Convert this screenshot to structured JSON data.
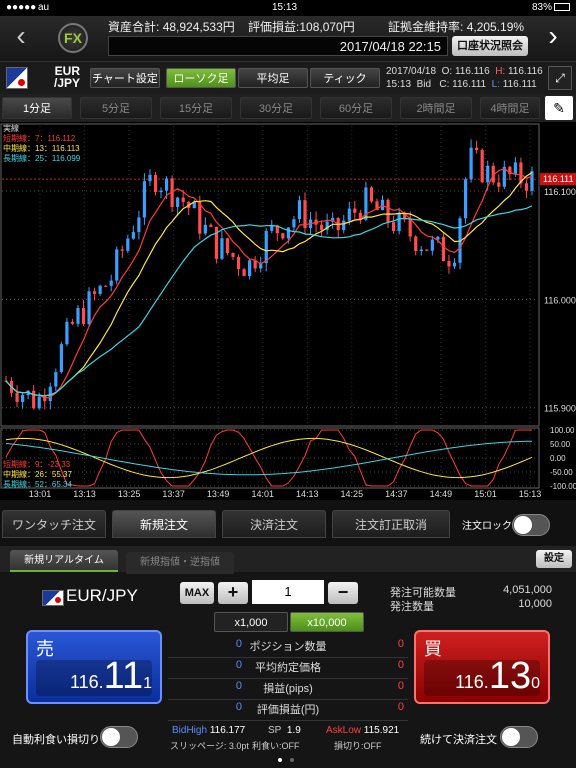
{
  "status_bar": {
    "carrier": "au",
    "time": "15:13",
    "battery": "83%"
  },
  "header": {
    "total_assets_label": "資産合計:",
    "total_assets": "48,924,533円",
    "unrealized_label": "評価損益:",
    "unrealized": "108,070円",
    "margin_label": "証拠金維持率:",
    "margin": "4,205.19%",
    "datetime": "2017/04/18 22:15",
    "account_button": "口座状況照会",
    "logo": "FX"
  },
  "toolbar": {
    "pair_top": "EUR",
    "pair_bottom": "/JPY",
    "chart_settings": "チャート設定",
    "candle": "ローソク足",
    "average": "平均足",
    "tick": "ティック",
    "ohlc_date": "2017/04/18",
    "ohlc_time": "15:13",
    "ohlc_side": "Bid",
    "o_label": "O:",
    "o_val": "116.116",
    "h_label": "H:",
    "h_val": "116.116",
    "c_label": "C:",
    "c_val": "116.111",
    "l_label": "L:",
    "l_val": "116.111"
  },
  "periods": [
    "1分足",
    "5分足",
    "15分足",
    "30分足",
    "60分足",
    "2時間足",
    "4時間足"
  ],
  "chart_data": {
    "type": "candlestick",
    "legend_title": "実線",
    "ma": [
      {
        "name": "短期線：7：116.112",
        "color": "#ff3b3b"
      },
      {
        "name": "中期線：13：116.113",
        "color": "#ffe63b"
      },
      {
        "name": "長期線：25：116.099",
        "color": "#3bd6e6"
      }
    ],
    "osc": [
      {
        "name": "短期線：9：-23.33",
        "color": "#ff3b3b"
      },
      {
        "name": "中期線：26：55.37",
        "color": "#ffe63b"
      },
      {
        "name": "長期線：52：65.34",
        "color": "#3bd6e6"
      }
    ],
    "y_ticks": [
      "116.100",
      "116.000",
      "115.900"
    ],
    "y_tick_values": [
      116.1,
      116.0,
      115.9
    ],
    "ylim": [
      115.885,
      116.16
    ],
    "current_price": "116.111",
    "osc_ticks": [
      "100.00",
      "50.00",
      "0.00",
      "-50.00",
      "-100.00"
    ],
    "x_ticks": [
      "13:01",
      "13:13",
      "13:25",
      "13:37",
      "13:49",
      "14:01",
      "14:13",
      "14:25",
      "14:37",
      "14:49",
      "15:01",
      "15:13"
    ]
  },
  "order_tabs": {
    "one_touch": "ワンタッチ注文",
    "new_order": "新規注文",
    "settle": "決済注文",
    "modify": "注文訂正取消",
    "lock": "注文ロック"
  },
  "panel": {
    "sub_tab_realtime": "新規リアルタイム",
    "sub_tab_limit": "新規指値・逆指値",
    "settings": "設定",
    "pair": "EUR/JPY",
    "max": "MAX",
    "plus": "+",
    "minus": "−",
    "qty": "1",
    "lot1": "x1,000",
    "lot2": "x10,000",
    "avail_label": "発注可能数量",
    "avail": "4,051,000",
    "order_qty_label": "発注数量",
    "order_qty": "10,000",
    "sell_label": "売",
    "sell_a": "116.",
    "sell_b": "11",
    "sell_c": "1",
    "buy_label": "買",
    "buy_a": "116.",
    "buy_b": "13",
    "buy_c": "0",
    "rows": [
      {
        "left": "0",
        "label": "ポジション数量",
        "right": "0"
      },
      {
        "left": "0",
        "label": "平均約定価格",
        "right": "0"
      },
      {
        "left": "0",
        "label": "損益(pips)",
        "right": "0"
      },
      {
        "left": "0",
        "label": "評価損益(円)",
        "right": "0"
      }
    ],
    "bidhigh_label": "BidHigh",
    "bidhigh": "116.177",
    "sp_label": "SP",
    "sp": "1.9",
    "asklow_label": "AskLow",
    "asklow": "115.921",
    "slippage": "スリッページ: 3.0pt",
    "take_profit": "利食い:OFF",
    "stop_loss": "損切り:OFF",
    "auto_label": "自動利食い損切り",
    "continuous_label": "続けて決済注文"
  },
  "colors": {
    "accent_green": "#6fb52c",
    "sell_blue": "#0a2f9c",
    "buy_red": "#a40000",
    "bid_blue": "#5a8cff",
    "ask_red": "#ff4040"
  }
}
